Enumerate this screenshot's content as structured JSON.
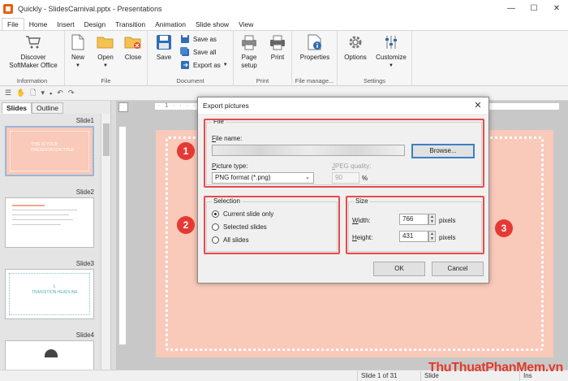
{
  "window": {
    "title": "Quickly - SlidesCarnival.pptx - Presentations",
    "controls": [
      "—",
      "☐",
      "✕"
    ]
  },
  "menu_tabs": [
    "File",
    "Home",
    "Insert",
    "Design",
    "Transition",
    "Animation",
    "Slide show",
    "View"
  ],
  "ribbon": {
    "information": {
      "label": "Information",
      "discover": "Discover\nSoftMaker Office"
    },
    "file": {
      "label": "File",
      "new": "New",
      "open": "Open",
      "close": "Close"
    },
    "document": {
      "label": "Document",
      "save": "Save",
      "save_as": "Save as",
      "save_all": "Save all",
      "export_as": "Export as"
    },
    "print": {
      "label": "Print",
      "page_setup": "Page\nsetup",
      "print": "Print"
    },
    "file_manage": {
      "label": "File manage...",
      "properties": "Properties"
    },
    "settings": {
      "label": "Settings",
      "options": "Options",
      "customize": "Customize"
    }
  },
  "panel": {
    "tabs": [
      "Slides",
      "Outline"
    ],
    "slides": [
      "Slide1",
      "Slide2",
      "Slide3",
      "Slide4"
    ],
    "thumb1_title": "THIS IS YOUR\nPRESENTATION TITLE",
    "thumb3_title": "1.\nTRANSITION HEADLINE"
  },
  "ruler": {
    "marks": "· 1 · · · · · · · · · · · · · · · · · · · · · · · · · · · · 9 · · · 10 · · · 11 ·"
  },
  "status": {
    "slide_of": "Slide 1 of 31",
    "slide": "Slide",
    "ins": "Ins"
  },
  "watermark": "ThuThuatPhanMem.vn",
  "dialog": {
    "title": "Export pictures",
    "file_group": "File",
    "file_name_label": "File name:",
    "file_name_value": "",
    "browse": "Browse...",
    "picture_type_label": "Picture type:",
    "picture_type_value": "PNG format (*.png)",
    "jpeg_quality_label": "JPEG quality:",
    "jpeg_quality_value": "90",
    "percent": "%",
    "selection_group": "Selection",
    "radio_current": "Current slide only",
    "radio_selected": "Selected slides",
    "radio_all": "All slides",
    "selected_option": "Current slide only",
    "size_group": "Size",
    "width_label": "Width:",
    "width_value": "766",
    "height_label": "Height:",
    "height_value": "431",
    "unit": "pixels",
    "ok": "OK",
    "cancel": "Cancel"
  },
  "badges": [
    "1",
    "2",
    "3"
  ],
  "colors": {
    "accent_red": "#e53935",
    "slide_bg": "#f9c9ba",
    "app_icon": "#e85d0a"
  }
}
